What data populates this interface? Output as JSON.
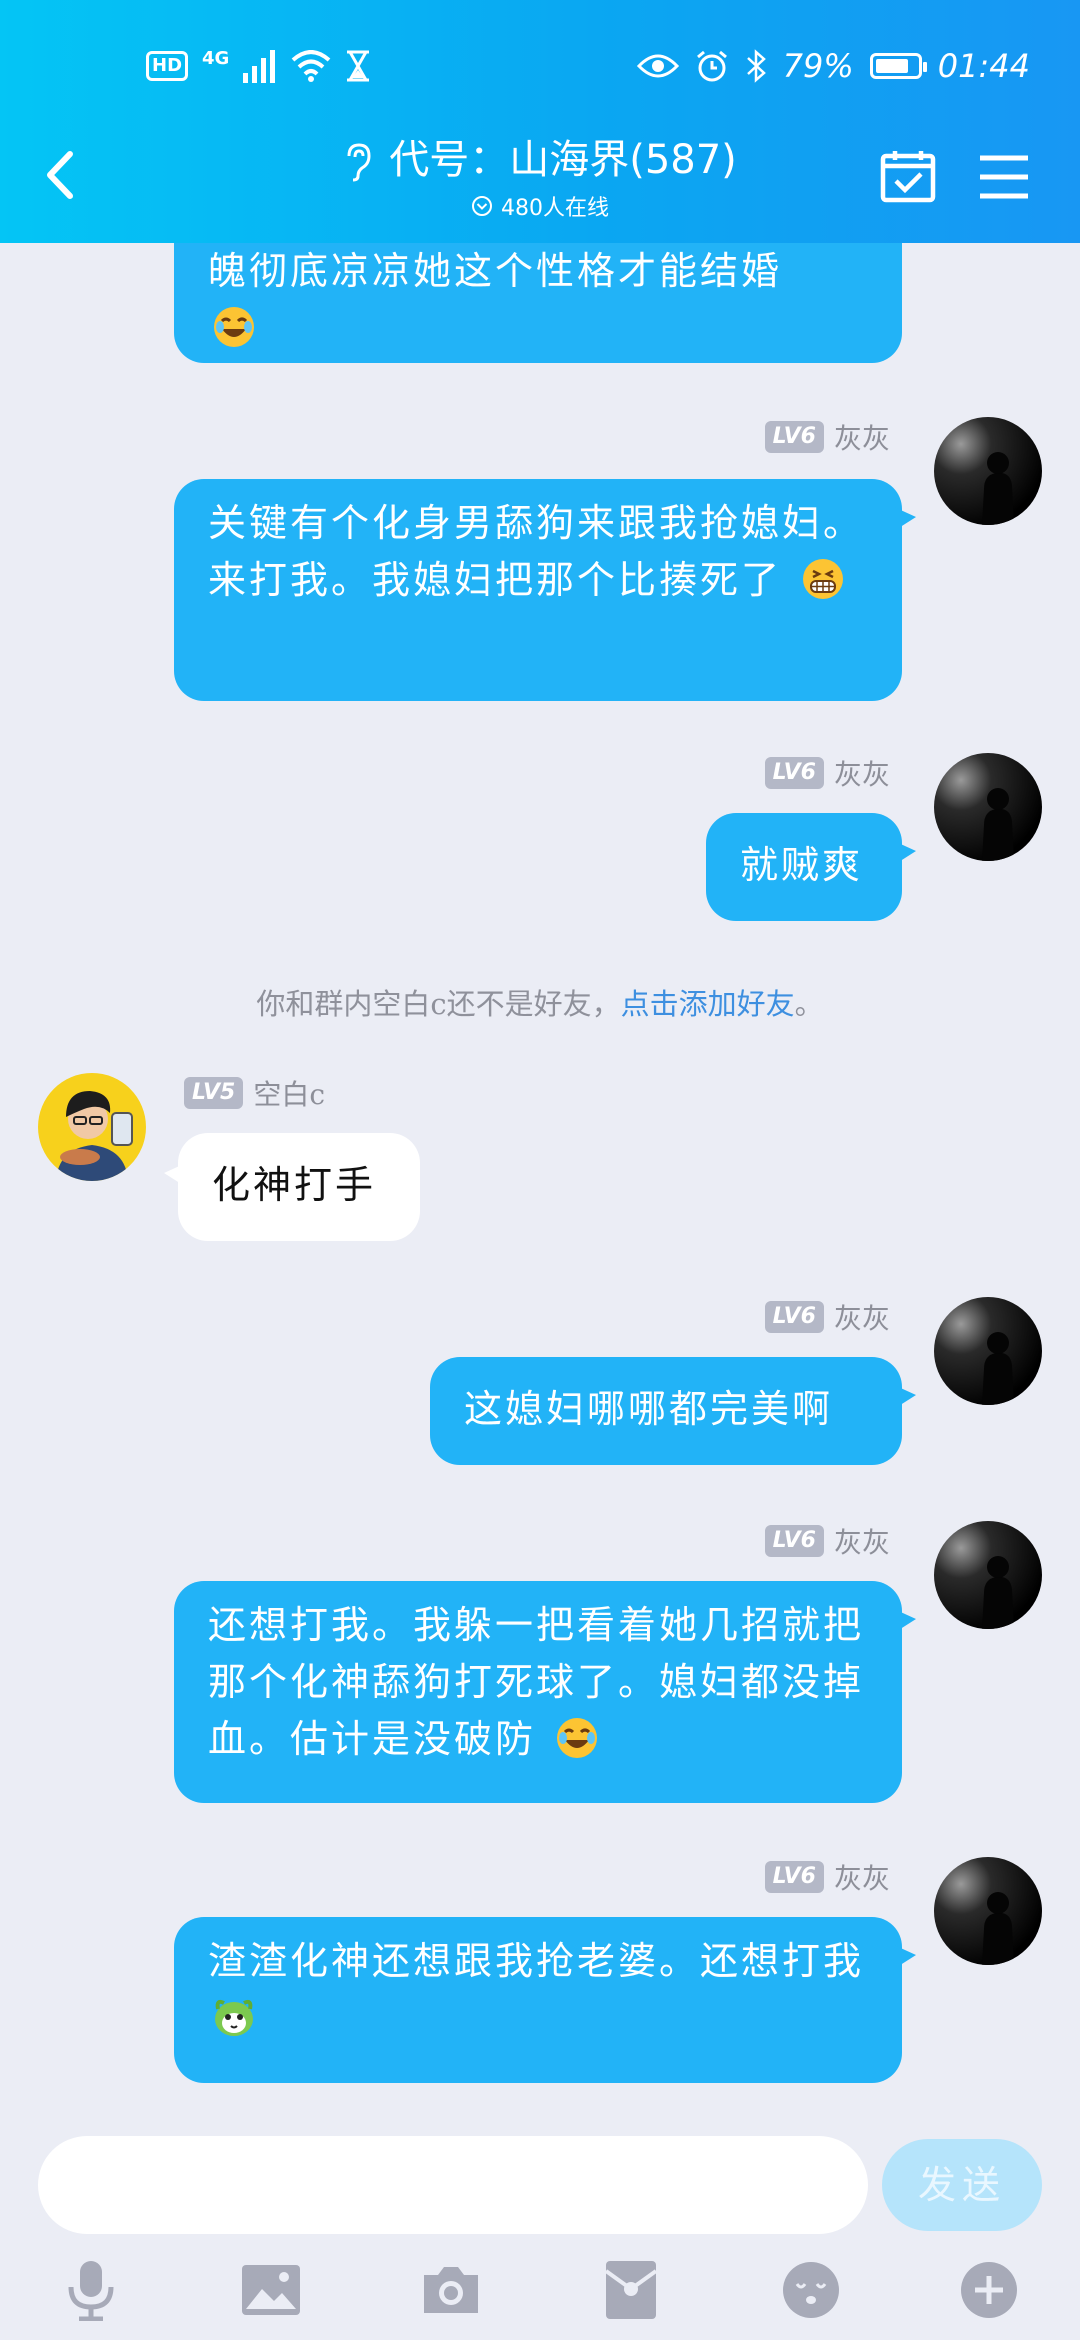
{
  "status_bar": {
    "hd": "HD",
    "network": "4G",
    "battery_text": "79%",
    "battery_level": 0.79,
    "time": "01:44"
  },
  "header": {
    "title": "代号：山海界(587)",
    "online": "480人在线"
  },
  "messages": [
    {
      "side": "right",
      "text": "魄彻底凉凉她这个性格才能结婚",
      "emoji": "laugh-tears"
    },
    {
      "side": "right",
      "level": "LV6",
      "name": "灰灰",
      "text": "关键有个化身男舔狗来跟我抢媳妇。来打我。我媳妇把那个比揍死了",
      "emoji": "grin"
    },
    {
      "side": "right",
      "level": "LV6",
      "name": "灰灰",
      "text": "就贼爽"
    },
    {
      "side": "left",
      "level": "LV5",
      "name": "空白c",
      "text": "化神打手"
    },
    {
      "side": "right",
      "level": "LV6",
      "name": "灰灰",
      "text": "这媳妇哪哪都完美啊"
    },
    {
      "side": "right",
      "level": "LV6",
      "name": "灰灰",
      "text": "还想打我。我躲一把看着她几招就把那个化神舔狗打死球了。媳妇都没掉血。估计是没破防",
      "emoji": "laugh-tears"
    },
    {
      "side": "right",
      "level": "LV6",
      "name": "灰灰",
      "text": "渣渣化神还想跟我抢老婆。还想打我",
      "emoji": "green-pet"
    }
  ],
  "system_notice": {
    "text": "你和群内空白c还不是好友，",
    "link": "点击添加好友",
    "suffix": "。"
  },
  "input": {
    "value": "",
    "send_label": "发送"
  },
  "toolbar": [
    "mic-icon",
    "image-icon",
    "camera-icon",
    "red-packet-icon",
    "emoji-icon",
    "plus-icon"
  ],
  "colors": {
    "header_start": "#04c5f5",
    "header_end": "#1897f3",
    "bubble_self": "#22b3f7",
    "background": "#ebedf5",
    "link": "#3d8fe0"
  }
}
